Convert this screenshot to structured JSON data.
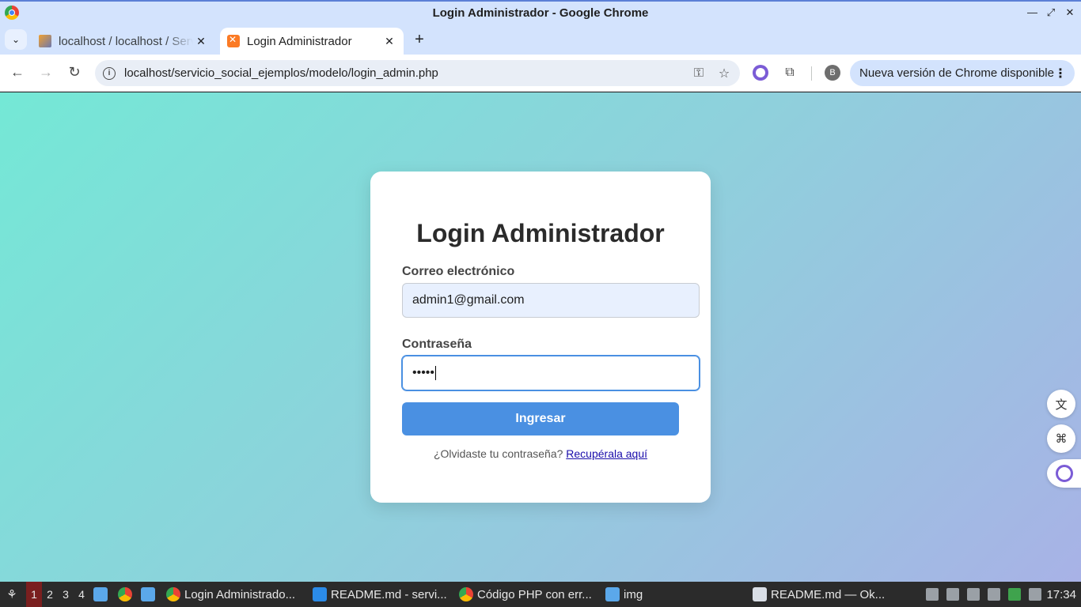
{
  "window": {
    "title": "Login Administrador - Google Chrome"
  },
  "tabs": [
    {
      "title": "localhost / localhost / Servidor",
      "icon": "phpmyadmin-icon",
      "active": false
    },
    {
      "title": "Login Administrador",
      "icon": "xampp-icon",
      "active": true
    }
  ],
  "toolbar": {
    "url": "localhost/servicio_social_ejemplos/modelo/login_admin.php",
    "profile_initial": "B",
    "update_label": "Nueva versión de Chrome disponible"
  },
  "page": {
    "heading": "Login Administrador",
    "email": {
      "label": "Correo electrónico",
      "value": "admin1@gmail.com"
    },
    "password": {
      "label": "Contraseña",
      "masked_value": "•••••"
    },
    "submit_label": "Ingresar",
    "forgot_prefix": "¿Olvidaste tu contraseña?",
    "forgot_link": "Recupérala aquí"
  },
  "taskbar": {
    "workspaces": [
      "1",
      "2",
      "3",
      "4"
    ],
    "active_workspace": "1",
    "tasks": [
      {
        "label": "Login Administrado...",
        "icon": "chrome-icon"
      },
      {
        "label": "README.md - servi...",
        "icon": "vscode-icon"
      },
      {
        "label": "Código PHP con err...",
        "icon": "chrome-icon"
      },
      {
        "label": "img",
        "icon": "folder-icon"
      },
      {
        "label": "README.md — Ok...",
        "icon": "okular-icon"
      }
    ],
    "clock": "17:34"
  },
  "colors": {
    "accent": "#4a90e2",
    "link": "#1a0dab",
    "background_start": "#74e8d6",
    "background_end": "#a8b2e6"
  }
}
